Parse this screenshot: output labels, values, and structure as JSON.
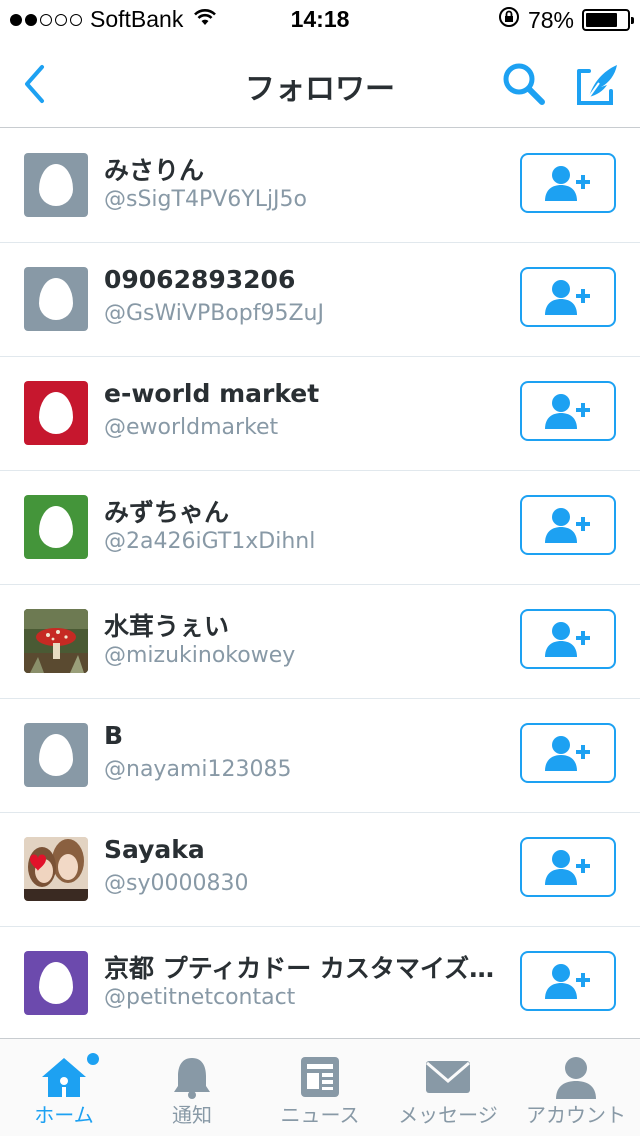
{
  "status_bar": {
    "carrier": "SoftBank",
    "time": "14:18",
    "battery": "78%",
    "battery_level": 0.78
  },
  "nav": {
    "title": "フォロワー",
    "back_icon": "chevron-left-icon",
    "search_icon": "search-icon",
    "compose_icon": "compose-icon"
  },
  "colors": {
    "accent": "#1da1f2",
    "default_avatar": "#8899a6",
    "red_avatar": "#c6172e",
    "green_avatar": "#44953a",
    "purple_avatar": "#6c4aad"
  },
  "users": [
    {
      "name": "みさりん",
      "handle": "@sSigT4PV6YLjJ5o",
      "avatar": "egg-gray"
    },
    {
      "name": "09062893206",
      "handle": "@GsWiVPBopf95ZuJ",
      "avatar": "egg-gray"
    },
    {
      "name": "e-world market",
      "handle": "@eworldmarket",
      "avatar": "egg-red"
    },
    {
      "name": "みずちゃん",
      "handle": "@2a426iGT1xDihnl",
      "avatar": "egg-green"
    },
    {
      "name": "水茸うぇい",
      "handle": "@mizukinokowey",
      "avatar": "photo-mushroom"
    },
    {
      "name": "B",
      "handle": "@nayami123085",
      "avatar": "egg-gray"
    },
    {
      "name": "Sayaka",
      "handle": "@sy0000830",
      "avatar": "photo-portrait"
    },
    {
      "name": "京都 プティカドー カスタマイズ…",
      "handle": "@petitnetcontact",
      "avatar": "egg-purple"
    }
  ],
  "tabs": [
    {
      "label": "ホーム",
      "icon": "home-icon",
      "active": true
    },
    {
      "label": "通知",
      "icon": "bell-icon",
      "active": false
    },
    {
      "label": "ニュース",
      "icon": "news-icon",
      "active": false
    },
    {
      "label": "メッセージ",
      "icon": "envelope-icon",
      "active": false
    },
    {
      "label": "アカウント",
      "icon": "person-icon",
      "active": false
    }
  ]
}
